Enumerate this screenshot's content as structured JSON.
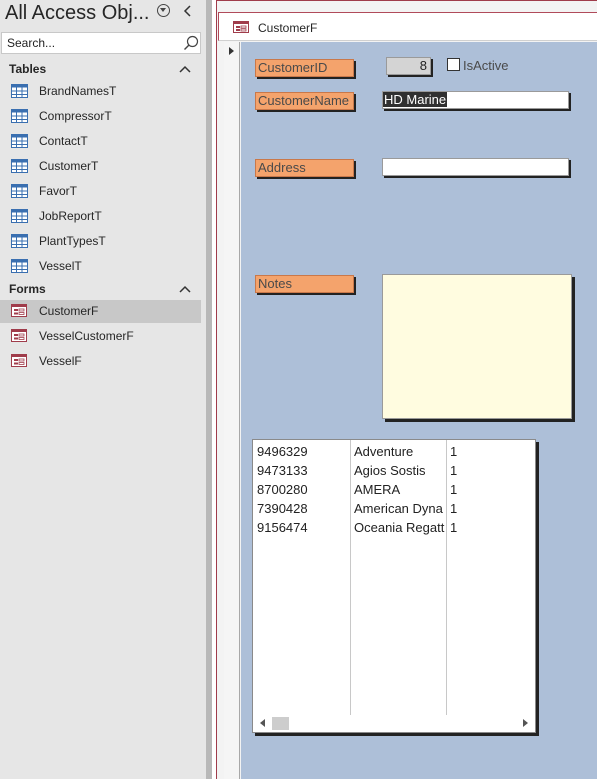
{
  "nav": {
    "title": "All Access Obj...",
    "search_placeholder": "Search...",
    "groups": [
      {
        "label": "Tables",
        "items": [
          {
            "label": "BrandNamesT"
          },
          {
            "label": "CompressorT"
          },
          {
            "label": "ContactT"
          },
          {
            "label": "CustomerT"
          },
          {
            "label": "FavorT"
          },
          {
            "label": "JobReportT"
          },
          {
            "label": "PlantTypesT"
          },
          {
            "label": "VesselT"
          }
        ]
      },
      {
        "label": "Forms",
        "items": [
          {
            "label": "CustomerF",
            "selected": true
          },
          {
            "label": "VesselCustomerF"
          },
          {
            "label": "VesselF"
          }
        ]
      }
    ]
  },
  "form": {
    "tab_title": "CustomerF",
    "fields": {
      "customer_id_label": "CustomerID",
      "customer_id_value": "8",
      "is_active_label": "IsActive",
      "is_active_checked": false,
      "customer_name_label": "CustomerName",
      "customer_name_value": "HD Marine",
      "address_label": "Address",
      "address_value": "",
      "notes_label": "Notes",
      "notes_value": ""
    },
    "vessel_list": [
      [
        "9496329",
        "Adventure",
        "1"
      ],
      [
        "9473133",
        "Agios Sostis",
        "1"
      ],
      [
        "8700280",
        "AMERA",
        "1"
      ],
      [
        "7390428",
        "American Dyna",
        "1"
      ],
      [
        "9156474",
        "Oceania Regatt",
        "1"
      ]
    ]
  },
  "colors": {
    "label_fill": "#f4a36c",
    "detail_background": "#adbfd8",
    "notes_background": "#fffce0",
    "tab_accent": "#a03c4b"
  },
  "icons": {
    "table": "table-icon",
    "form": "form-icon",
    "search": "search-icon"
  }
}
